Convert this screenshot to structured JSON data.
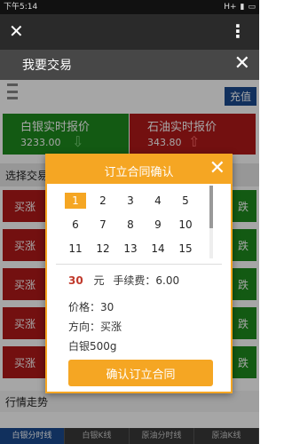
{
  "status_bar": {
    "time": "下午5:14",
    "network": "H+",
    "battery": ""
  },
  "app_bar": {
    "close_glyph": "✕",
    "menu_glyph": "⋮"
  },
  "page": {
    "title": "我要交易",
    "close_glyph": "✕"
  },
  "toolbar": {
    "recharge_label": "充值"
  },
  "quotes": [
    {
      "name": "白银实时报价",
      "price": "3233.00",
      "arrow": "⇩",
      "color": "#1e8a1e"
    },
    {
      "name": "石油实时报价",
      "price": "343.80",
      "arrow": "⇧",
      "color": "#b11a1a"
    }
  ],
  "section": {
    "select_label": "选择交易"
  },
  "trade_rows": {
    "buy_label": "买涨",
    "sell_label": "跌",
    "count": 5
  },
  "trend": {
    "label": "行情走势"
  },
  "chart_tabs": [
    "白银分时线",
    "白银K线",
    "原油分时线",
    "原油K线"
  ],
  "modal": {
    "title": "订立合同确认",
    "close_glyph": "✕",
    "numbers": [
      "1",
      "2",
      "3",
      "4",
      "5",
      "6",
      "7",
      "8",
      "9",
      "10",
      "11",
      "12",
      "13",
      "14",
      "15"
    ],
    "selected": "1",
    "quantity": "30",
    "unit": "元",
    "fee_label": "手续费：6.00",
    "price_line": "价格：30",
    "direction_line": "方向：买涨",
    "product_line": "白银500g",
    "confirm_label": "确认订立合同"
  }
}
